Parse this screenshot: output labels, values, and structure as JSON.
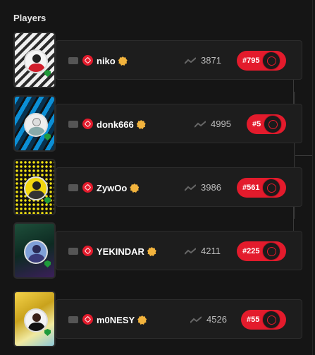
{
  "section_title": "Players",
  "players": [
    {
      "name": "niko",
      "elo": "3871",
      "rank": "#795"
    },
    {
      "name": "donk666",
      "elo": "4995",
      "rank": "#5"
    },
    {
      "name": "ZywOo",
      "elo": "3986",
      "rank": "#561"
    },
    {
      "name": "YEKINDAR",
      "elo": "4211",
      "rank": "#225"
    },
    {
      "name": "m0NESY",
      "elo": "4526",
      "rank": "#55"
    }
  ],
  "colors": {
    "accent": "#e31b2c",
    "verified": "#f2b33d",
    "background": "#151515",
    "card": "#1d1d1d"
  },
  "icons": {
    "flag": "flag-icon",
    "level": "faceit-level-icon",
    "verified": "verified-icon",
    "elo": "trend-icon",
    "rank": "rank-badge-icon",
    "shield": "shield-icon"
  }
}
